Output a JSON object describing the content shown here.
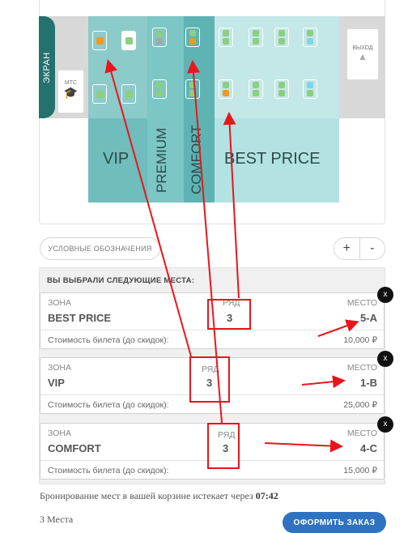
{
  "map": {
    "screen_label": "ЭКРАН",
    "mts_label": "МТС",
    "exit_label": "ВЫХОД",
    "zones": {
      "vip": "VIP",
      "premium": "PREMIUM",
      "comfort": "COMFORT",
      "best_price": "BEST PRICE"
    }
  },
  "controls": {
    "legend_label": "УСЛОВНЫЕ ОБОЗНАЧЕНИЯ",
    "zoom_in": "+",
    "zoom_out": "-"
  },
  "selection": {
    "header": "ВЫ ВЫБРАЛИ СЛЕДУЮЩИЕ МЕСТА:",
    "zone_label": "ЗОНА",
    "row_label": "РЯД",
    "seat_label": "МЕСТО",
    "price_label": "Стоимость билета (до скидок):",
    "close_symbol": "x",
    "items": [
      {
        "zone": "BEST PRICE",
        "row": "3",
        "seat": "5-А",
        "price": "10,000 ₽"
      },
      {
        "zone": "VIP",
        "row": "3",
        "seat": "1-В",
        "price": "25,000 ₽"
      },
      {
        "zone": "COMFORT",
        "row": "3",
        "seat": "4-С",
        "price": "15,000 ₽"
      }
    ]
  },
  "footer": {
    "expire_text": "Бронирование мест в вашей корзине истекает через",
    "expire_time": "07:42",
    "count_text": "3 Места",
    "order_button": "ОФОРМИТЬ ЗАКАЗ"
  },
  "colors": {
    "screen": "#23726e",
    "seat_free": "#8dcf7f",
    "seat_selected": "#f39a1d",
    "seat_blue": "#7dd6e8",
    "seat_taken": "#9fa9a9",
    "annotation": "#e8161b",
    "order_button": "#2f72c0"
  }
}
